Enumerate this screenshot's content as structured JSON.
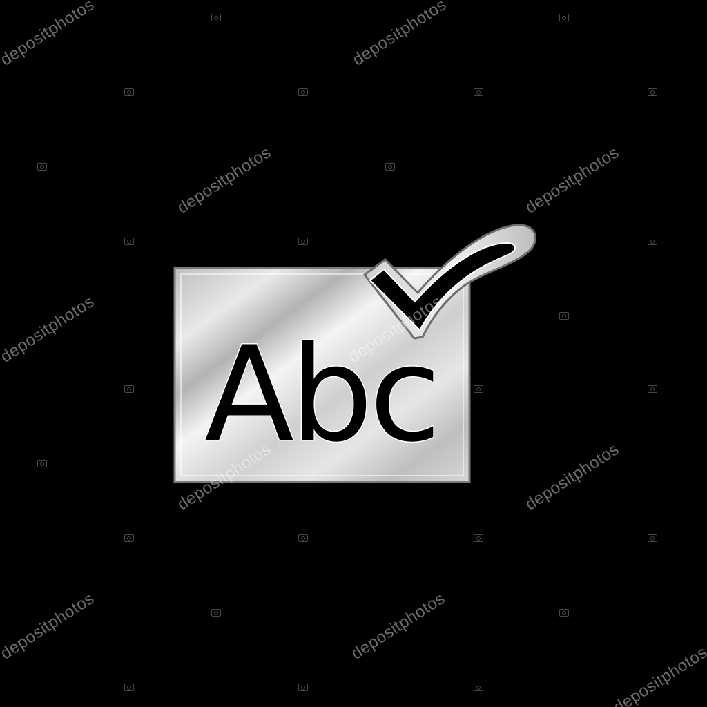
{
  "icon": {
    "name": "spell-check-icon",
    "label": "Abc",
    "colors": {
      "background": "#000000",
      "silver_light": "#f2f2f2",
      "silver_mid": "#c9c9c9",
      "silver_dark": "#8e8e8e",
      "ink": "#000000"
    }
  },
  "watermark": {
    "text": "depositphotos"
  }
}
